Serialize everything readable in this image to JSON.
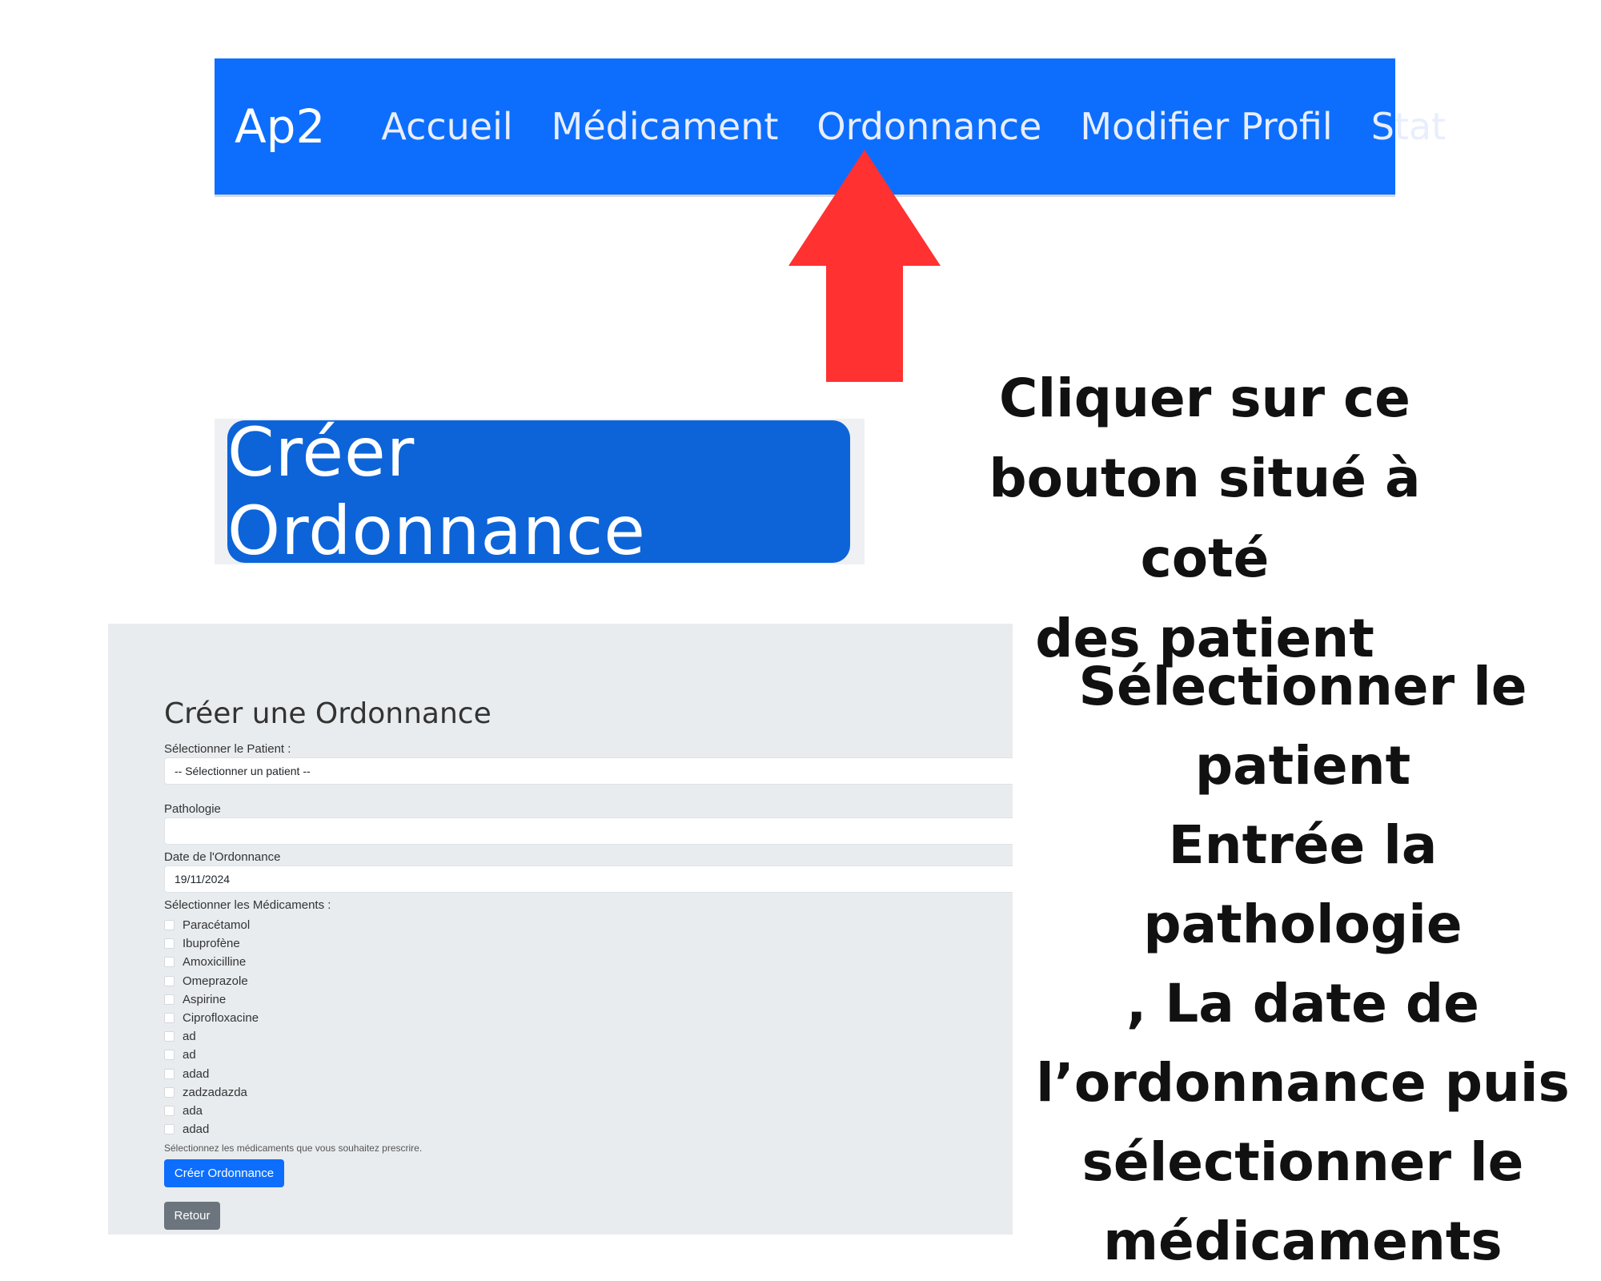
{
  "navbar": {
    "brand": "Ap2",
    "links": [
      "Accueil",
      "Médicament",
      "Ordonnance",
      "Modifier Profil",
      "Stat"
    ],
    "background_color": "#0d6efd"
  },
  "pointer_arrow": {
    "icon": "red-up-arrow-icon",
    "color": "#ff3131"
  },
  "big_button": {
    "label": "Créer Ordonnance",
    "color": "#0d64d8"
  },
  "instructions": {
    "step1": "Cliquer sur ce\nbouton situé à coté\ndes patient",
    "step2": "Sélectionner le\npatient\nEntrée la pathologie\n, La date de\nl’ordonnance puis\nsélectionner le\nmédicaments"
  },
  "form": {
    "title": "Créer une Ordonnance",
    "patient_label": "Sélectionner le Patient :",
    "patient_selected": "-- Sélectionner un patient --",
    "pathologie_label": "Pathologie",
    "pathologie_value": "",
    "date_label": "Date de l'Ordonnance",
    "date_value": "19/11/2024",
    "medicaments_label": "Sélectionner les Médicaments :",
    "medicaments": [
      "Paracétamol",
      "Ibuprofène",
      "Amoxicilline",
      "Omeprazole",
      "Aspirine",
      "Ciprofloxacine",
      "ad",
      "ad",
      "adad",
      "zadzadazda",
      "ada",
      "adad"
    ],
    "help_text": "Sélectionnez les médicaments que vous souhaitez prescrire.",
    "submit_label": "Créer Ordonnance",
    "back_label": "Retour",
    "panel_background": "#e9ecef"
  }
}
